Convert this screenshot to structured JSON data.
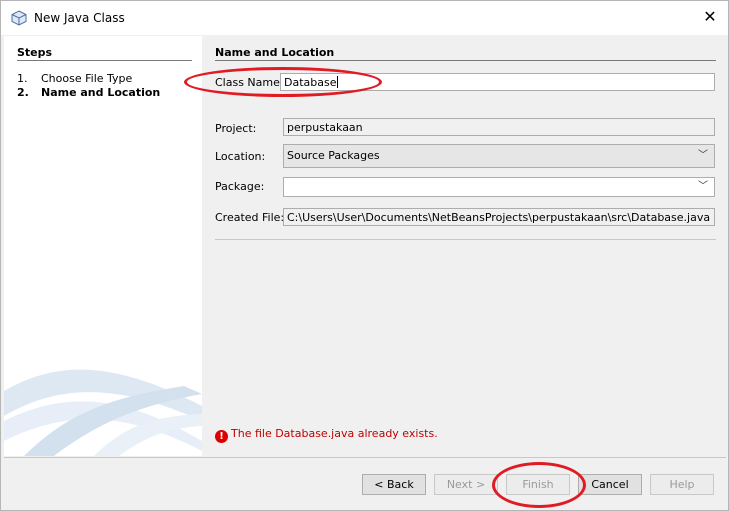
{
  "window": {
    "title": "New Java Class",
    "close_glyph": "✕"
  },
  "steps": {
    "heading": "Steps",
    "items": [
      {
        "num": "1.",
        "label": "Choose File Type"
      },
      {
        "num": "2.",
        "label": "Name and Location"
      }
    ]
  },
  "form": {
    "heading": "Name and Location",
    "class_name_label": "Class Name:",
    "class_name_value": "Database",
    "project_label": "Project:",
    "project_value": "perpustakaan",
    "location_label": "Location:",
    "location_value": "Source Packages",
    "package_label": "Package:",
    "package_value": "",
    "created_file_label": "Created File:",
    "created_file_value": "C:\\Users\\User\\Documents\\NetBeansProjects\\perpustakaan\\src\\Database.java"
  },
  "error": {
    "message": "The file Database.java already exists.",
    "icon": "error-icon"
  },
  "buttons": {
    "back": "< Back",
    "next": "Next >",
    "finish": "Finish",
    "cancel": "Cancel",
    "help": "Help"
  },
  "colors": {
    "annotation": "#e01b24",
    "error": "#c00000"
  }
}
